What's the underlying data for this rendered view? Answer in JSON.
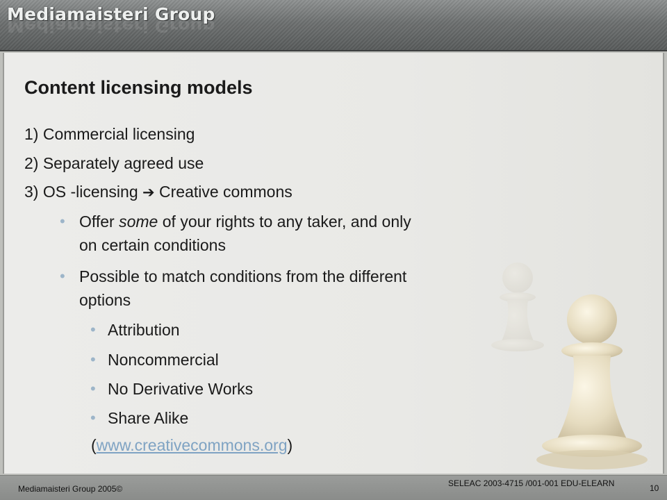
{
  "header": {
    "logo_text": "Mediamaisteri Group"
  },
  "slide": {
    "title": "Content licensing models",
    "items": [
      "1) Commercial licensing",
      "2) Separately agreed use",
      "3) OS -licensing"
    ],
    "arrow_glyph": "➔",
    "item3_suffix": "Creative commons",
    "bullet1": {
      "before": "Offer ",
      "emphasis": "some",
      "after_line1": " of your rights to any taker, and only",
      "line2": "on certain conditions"
    },
    "bullet2": {
      "line1": "Possible to match conditions from the different",
      "line2": "options"
    },
    "sub_bullets": [
      "Attribution",
      "Noncommercial",
      "No Derivative Works",
      "Share Alike"
    ],
    "link": {
      "open_paren": "(",
      "text": "www.creativecommons.org",
      "close_paren": ")"
    },
    "bullet_color": "#9db5c9",
    "link_color": "#7fa3c3"
  },
  "footer": {
    "left_text": "Mediamaisteri Group 2005©",
    "right_text": "SELEAC 2003-4715 /001-001 EDU-ELEARN",
    "page_number": "10"
  }
}
